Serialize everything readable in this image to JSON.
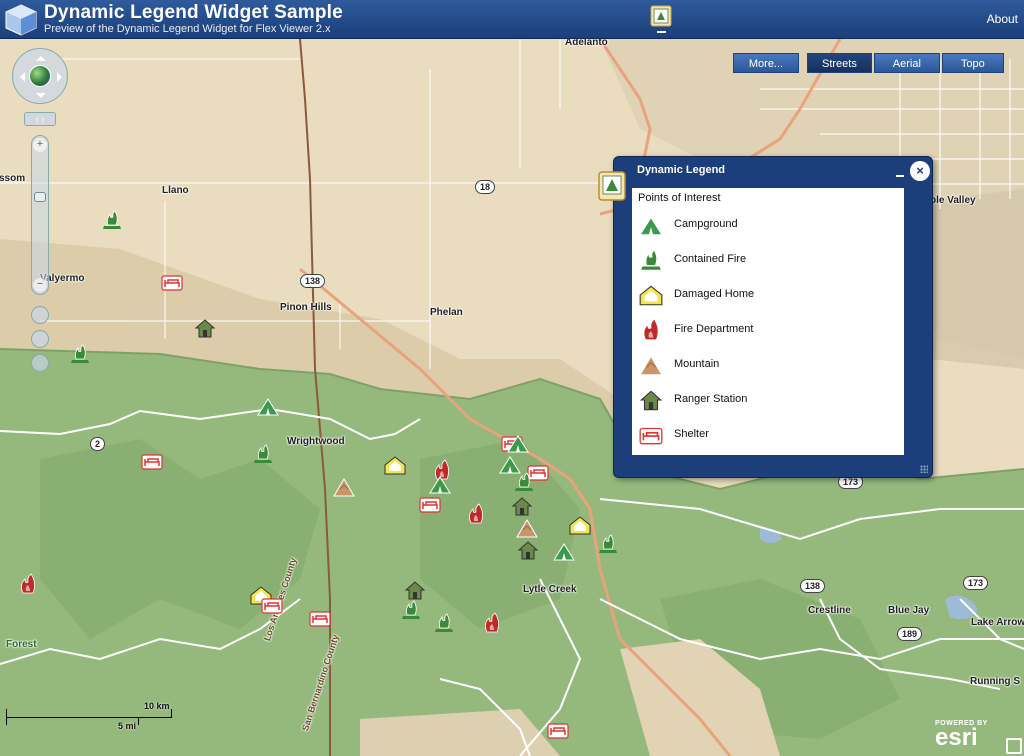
{
  "header": {
    "title": "Dynamic Legend Widget Sample",
    "subtitle": "Preview of the Dynamic Legend Widget for Flex Viewer 2.x",
    "about": "About"
  },
  "basemap": {
    "more": "More...",
    "options": [
      "Streets",
      "Aerial",
      "Topo"
    ],
    "selected": "Streets"
  },
  "navigation": {
    "nav_sub": "‹ ›",
    "zoom_in": "+",
    "zoom_out": "−"
  },
  "legend": {
    "title": "Dynamic Legend",
    "close": "×",
    "layer_name": "Points of Interest",
    "items": [
      {
        "label": "Campground",
        "icon": "campground-icon"
      },
      {
        "label": "Contained Fire",
        "icon": "contained-fire-icon"
      },
      {
        "label": "Damaged Home",
        "icon": "damaged-home-icon"
      },
      {
        "label": "Fire Department",
        "icon": "fire-department-icon"
      },
      {
        "label": "Mountain",
        "icon": "mountain-icon"
      },
      {
        "label": "Ranger Station",
        "icon": "ranger-station-icon"
      },
      {
        "label": "Shelter",
        "icon": "shelter-icon"
      }
    ]
  },
  "map_labels": {
    "adelanto": "Adelanto",
    "llano": "Llano",
    "valyermo": "Valyermo",
    "pinon_hills": "Pinon Hills",
    "phelan": "Phelan",
    "wrightwood": "Wrightwood",
    "lytle_creek": "Lytle Creek",
    "crestline": "Crestline",
    "blue_jay": "Blue Jay",
    "lake_arrow": "Lake Arrow",
    "running_s": "Running S",
    "forest": "Forest",
    "ssom": "ssom",
    "ple_valley": "ple Valley",
    "la_county": "Los Angeles County",
    "sb_county": "San Bernardino County"
  },
  "route_shields": [
    "18",
    "138",
    "2",
    "173",
    "138",
    "189",
    "173"
  ],
  "scale": {
    "km": "10 km",
    "mi": "5 mi"
  },
  "attribution": {
    "powered": "POWERED BY",
    "brand": "esri"
  },
  "colors": {
    "header": "#1b3f7a",
    "desert": "#e8dcc0",
    "forest": "#93b87c",
    "roads": "#ffffff",
    "highway": "#e8a77e"
  }
}
